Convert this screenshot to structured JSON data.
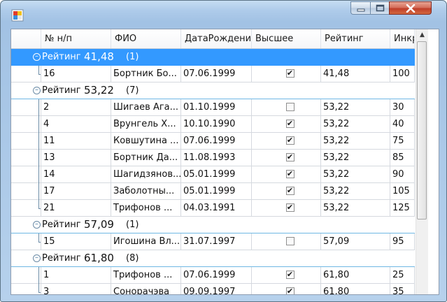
{
  "window": {
    "buttons": {
      "minimize": "–",
      "maximize": "□",
      "close": "✕"
    },
    "icon": "app-window-icon"
  },
  "grid": {
    "columns": [
      {
        "label": ""
      },
      {
        "label": "№ н/п"
      },
      {
        "label": "ФИО"
      },
      {
        "label": "ДатаРождени"
      },
      {
        "label": "Высшее"
      },
      {
        "label": "Рейтинг"
      },
      {
        "label": "Инкр"
      }
    ],
    "groups": [
      {
        "label": "Рейтинг",
        "value": "41,48",
        "count": "(1)",
        "selected": true,
        "rows": [
          {
            "num": "16",
            "fio": "Бортник Бо...",
            "date": "07.06.1999",
            "higher": true,
            "rating": "41,48",
            "incr": "100"
          }
        ]
      },
      {
        "label": "Рейтинг",
        "value": "53,22",
        "count": "(7)",
        "selected": false,
        "rows": [
          {
            "num": "2",
            "fio": "Шигаев Ага...",
            "date": "01.10.1999",
            "higher": false,
            "rating": "53,22",
            "incr": "30"
          },
          {
            "num": "4",
            "fio": "Врунгель Х...",
            "date": "10.10.1990",
            "higher": true,
            "rating": "53,22",
            "incr": "40"
          },
          {
            "num": "11",
            "fio": "Ковшутина ...",
            "date": "07.06.1999",
            "higher": true,
            "rating": "53,22",
            "incr": "75"
          },
          {
            "num": "13",
            "fio": "Бортник Да...",
            "date": "11.08.1993",
            "higher": true,
            "rating": "53,22",
            "incr": "85"
          },
          {
            "num": "14",
            "fio": "Шагидзянов...",
            "date": "05.01.1999",
            "higher": true,
            "rating": "53,22",
            "incr": "90"
          },
          {
            "num": "17",
            "fio": "Заболотны...",
            "date": "05.01.1999",
            "higher": true,
            "rating": "53,22",
            "incr": "105"
          },
          {
            "num": "21",
            "fio": "Трифонов ...",
            "date": "04.03.1991",
            "higher": true,
            "rating": "53,22",
            "incr": "125"
          }
        ]
      },
      {
        "label": "Рейтинг",
        "value": "57,09",
        "count": "(1)",
        "selected": false,
        "rows": [
          {
            "num": "15",
            "fio": "Игошина Вл...",
            "date": "31.07.1997",
            "higher": false,
            "rating": "57,09",
            "incr": "95"
          }
        ]
      },
      {
        "label": "Рейтинг",
        "value": "61,80",
        "count": "(8)",
        "selected": false,
        "rows": [
          {
            "num": "1",
            "fio": "Трифонов ...",
            "date": "07.06.1999",
            "higher": true,
            "rating": "61,80",
            "incr": "25"
          },
          {
            "num": "3",
            "fio": "Сонорачэва",
            "date": "09.09.1997",
            "higher": true,
            "rating": "61,80",
            "incr": "35"
          }
        ]
      }
    ]
  },
  "scrollbar": {
    "up_arrow": "▲",
    "position": 0.0
  }
}
